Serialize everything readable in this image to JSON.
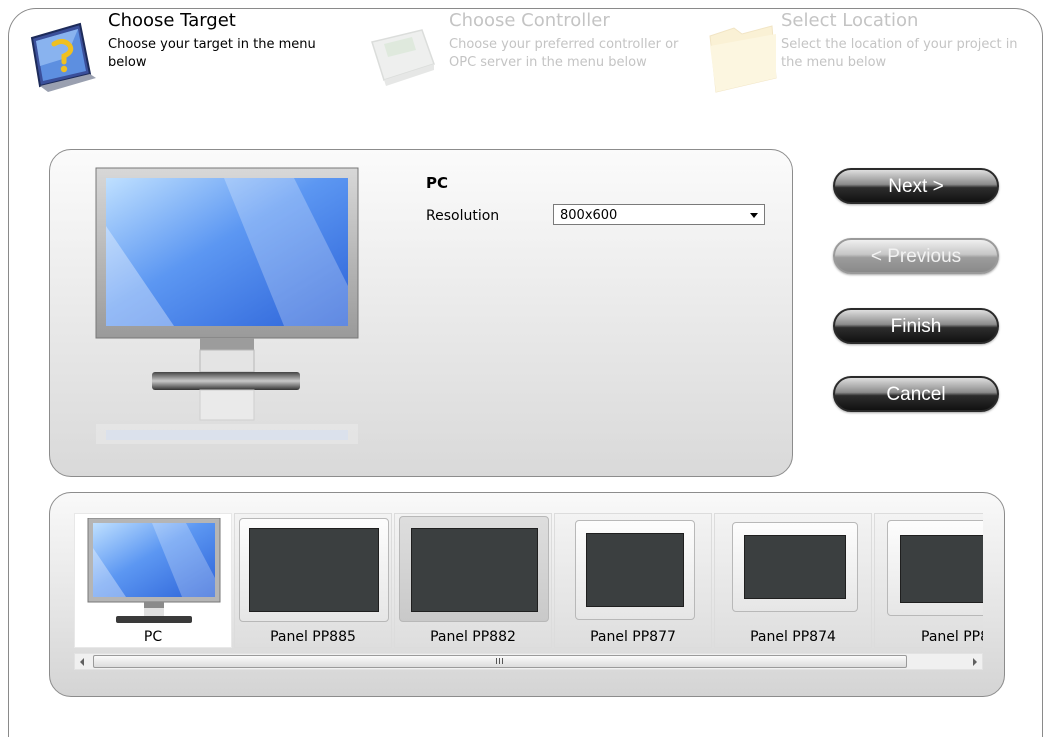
{
  "steps": [
    {
      "title": "Choose Target",
      "description": "Choose your target in the menu below",
      "icon": "target-question-icon"
    },
    {
      "title": "Choose Controller",
      "description": "Choose your preferred controller or OPC server in the menu below",
      "icon": "controller-icon"
    },
    {
      "title": "Select Location",
      "description": "Select the location of your project in the menu below",
      "icon": "folder-icon"
    }
  ],
  "detail": {
    "target_name": "PC",
    "resolution_label": "Resolution",
    "resolution_value": "800x600"
  },
  "buttons": {
    "next": "Next >",
    "previous": "< Previous",
    "finish": "Finish",
    "cancel": "Cancel"
  },
  "devices": [
    {
      "label": "PC",
      "selected": true
    },
    {
      "label": "Panel PP885",
      "selected": false
    },
    {
      "label": "Panel PP882",
      "selected": false
    },
    {
      "label": "Panel PP877",
      "selected": false
    },
    {
      "label": "Panel PP874",
      "selected": false
    },
    {
      "label": "Panel PP8",
      "selected": false
    }
  ],
  "scrollbar": {
    "thumb_glyph": "III"
  },
  "colors": {
    "button_dark": "#1a1a1a",
    "monitor_screen": "#4d86f0",
    "panel_screen": "#3b3f40",
    "panel_logo": "#d00000"
  }
}
